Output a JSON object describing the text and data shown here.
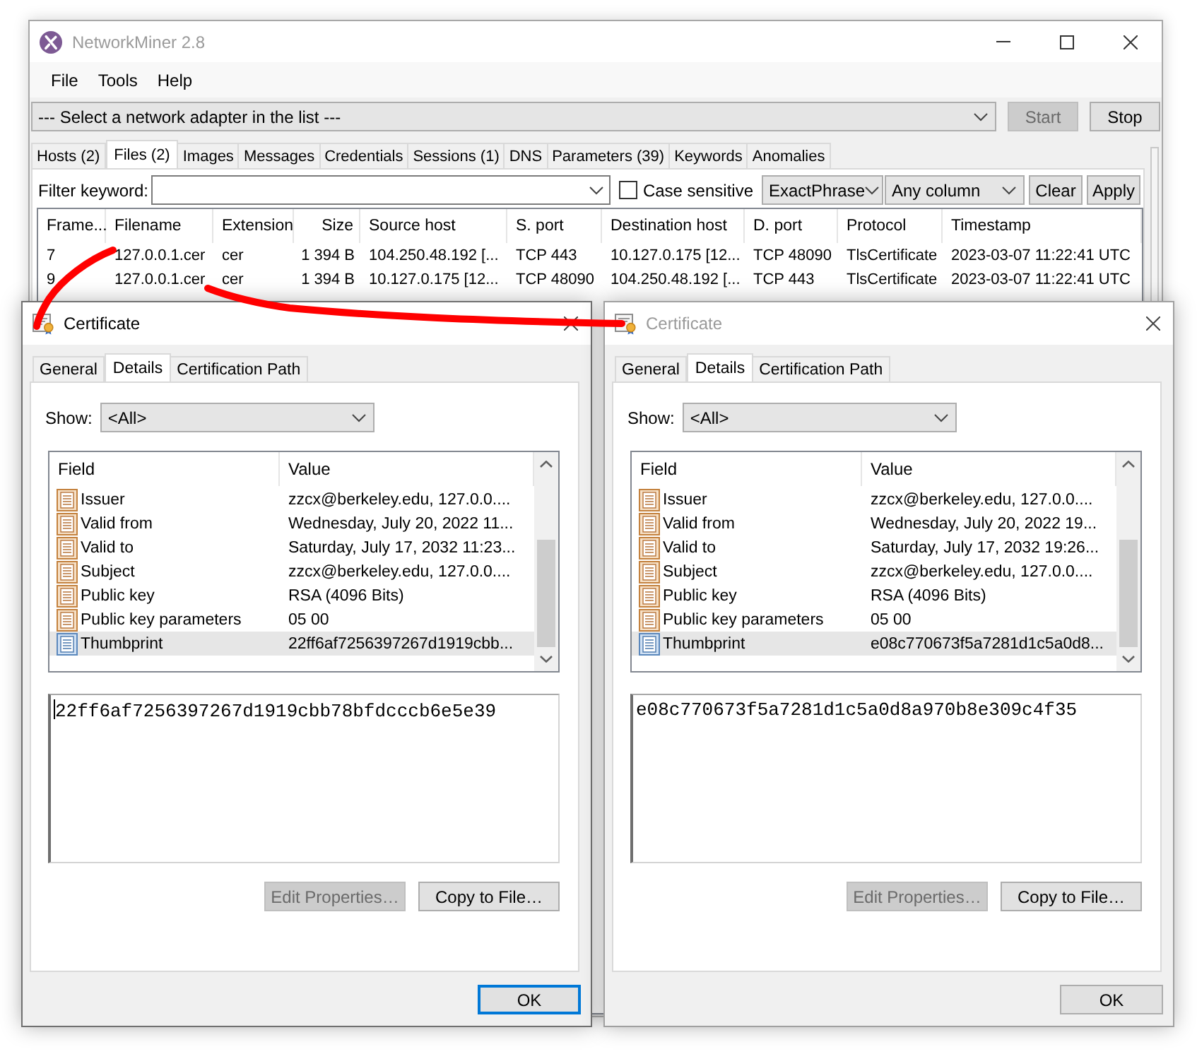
{
  "main_window": {
    "title": "NetworkMiner 2.8",
    "active": false,
    "menu": [
      "File",
      "Tools",
      "Help"
    ],
    "adapter_select": {
      "value": "--- Select a network adapter in the list ---"
    },
    "capture_buttons": [
      {
        "label": "Start",
        "disabled": true
      },
      {
        "label": "Stop",
        "disabled": false
      }
    ],
    "tabs": [
      {
        "label": "Hosts (2)",
        "selected": false
      },
      {
        "label": "Files (2)",
        "selected": true
      },
      {
        "label": "Images",
        "selected": false
      },
      {
        "label": "Messages",
        "selected": false
      },
      {
        "label": "Credentials",
        "selected": false
      },
      {
        "label": "Sessions (1)",
        "selected": false
      },
      {
        "label": "DNS",
        "selected": false
      },
      {
        "label": "Parameters (39)",
        "selected": false
      },
      {
        "label": "Keywords",
        "selected": false
      },
      {
        "label": "Anomalies",
        "selected": false
      }
    ],
    "filter": {
      "label": "Filter keyword:",
      "case_sensitive": {
        "label": "Case sensitive",
        "checked": false
      },
      "match_mode": "ExactPhrase",
      "column_scope": "Any column",
      "buttons": [
        "Clear",
        "Apply"
      ]
    },
    "files_table": {
      "columns": [
        {
          "label": "Frame...",
          "kind": "text"
        },
        {
          "label": "Filename",
          "kind": "text"
        },
        {
          "label": "Extension",
          "kind": "text"
        },
        {
          "label": "Size",
          "kind": "number"
        },
        {
          "label": "Source host",
          "kind": "text"
        },
        {
          "label": "S. port",
          "kind": "text"
        },
        {
          "label": "Destination host",
          "kind": "text"
        },
        {
          "label": "D. port",
          "kind": "text"
        },
        {
          "label": "Protocol",
          "kind": "text"
        },
        {
          "label": "Timestamp",
          "kind": "text"
        }
      ],
      "rows": [
        [
          "7",
          "127.0.0.1.cer",
          "cer",
          "1 394 B",
          "104.250.48.192 [...",
          "TCP 443",
          "10.127.0.175 [12...",
          "TCP 48090",
          "TlsCertificate",
          "2023-03-07 11:22:41 UTC"
        ],
        [
          "9",
          "127.0.0.1.cer",
          "cer",
          "1 394 B",
          "10.127.0.175 [12...",
          "TCP 48090",
          "104.250.48.192 [...",
          "TCP 443",
          "TlsCertificate",
          "2023-03-07 11:22:41 UTC"
        ]
      ]
    }
  },
  "certificate_dialogs": [
    {
      "title": "Certificate",
      "active": true,
      "tabs": [
        {
          "label": "General",
          "selected": false
        },
        {
          "label": "Details",
          "selected": true
        },
        {
          "label": "Certification Path",
          "selected": false
        }
      ],
      "show": {
        "label": "Show:",
        "value": "<All>"
      },
      "list_columns": [
        "Field",
        "Value"
      ],
      "fields": [
        {
          "name": "Issuer",
          "value": "zzcx@berkeley.edu, 127.0.0....",
          "kind": "field",
          "selected": false
        },
        {
          "name": "Valid from",
          "value": "Wednesday, July 20, 2022 11...",
          "kind": "field",
          "selected": false
        },
        {
          "name": "Valid to",
          "value": "Saturday, July 17, 2032 11:23...",
          "kind": "field",
          "selected": false
        },
        {
          "name": "Subject",
          "value": "zzcx@berkeley.edu, 127.0.0....",
          "kind": "field",
          "selected": false
        },
        {
          "name": "Public key",
          "value": "RSA (4096 Bits)",
          "kind": "field",
          "selected": false
        },
        {
          "name": "Public key parameters",
          "value": "05 00",
          "kind": "field",
          "selected": false
        },
        {
          "name": "Thumbprint",
          "value": "22ff6af7256397267d1919cbb...",
          "kind": "property",
          "selected": true
        }
      ],
      "value_text": "22ff6af7256397267d1919cbb78bfdcccb6e5e39",
      "buttons": [
        {
          "label": "Edit Properties…",
          "disabled": true
        },
        {
          "label": "Copy to File…",
          "disabled": false
        }
      ],
      "ok_button": "OK"
    },
    {
      "title": "Certificate",
      "active": false,
      "tabs": [
        {
          "label": "General",
          "selected": false
        },
        {
          "label": "Details",
          "selected": true
        },
        {
          "label": "Certification Path",
          "selected": false
        }
      ],
      "show": {
        "label": "Show:",
        "value": "<All>"
      },
      "list_columns": [
        "Field",
        "Value"
      ],
      "fields": [
        {
          "name": "Issuer",
          "value": "zzcx@berkeley.edu, 127.0.0....",
          "kind": "field",
          "selected": false
        },
        {
          "name": "Valid from",
          "value": "Wednesday, July 20, 2022 19...",
          "kind": "field",
          "selected": false
        },
        {
          "name": "Valid to",
          "value": "Saturday, July 17, 2032 19:26...",
          "kind": "field",
          "selected": false
        },
        {
          "name": "Subject",
          "value": "zzcx@berkeley.edu, 127.0.0....",
          "kind": "field",
          "selected": false
        },
        {
          "name": "Public key",
          "value": "RSA (4096 Bits)",
          "kind": "field",
          "selected": false
        },
        {
          "name": "Public key parameters",
          "value": "05 00",
          "kind": "field",
          "selected": false
        },
        {
          "name": "Thumbprint",
          "value": "e08c770673f5a7281d1c5a0d8...",
          "kind": "property",
          "selected": true
        }
      ],
      "value_text": "e08c770673f5a7281d1c5a0d8a970b8e309c4f35",
      "buttons": [
        {
          "label": "Edit Properties…",
          "disabled": true
        },
        {
          "label": "Copy to File…",
          "disabled": false
        }
      ],
      "ok_button": "OK"
    }
  ]
}
